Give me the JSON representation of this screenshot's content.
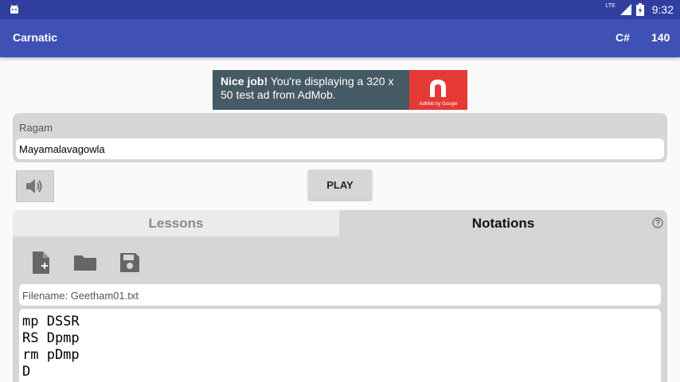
{
  "status_bar": {
    "network": "LTE",
    "time": "9:32"
  },
  "app_bar": {
    "title": "Carnatic",
    "key": "C#",
    "tempo": "140"
  },
  "ad": {
    "bold_text": "Nice job!",
    "text": " You're displaying a 320 x 50 test ad from AdMob.",
    "logo_caption": "AdMob by Google"
  },
  "ragam": {
    "label": "Ragam",
    "value": "Mayamalavagowla"
  },
  "controls": {
    "play_label": "PLAY"
  },
  "tabs": [
    {
      "label": "Lessons"
    },
    {
      "label": "Notations"
    }
  ],
  "notations": {
    "filename": "Filename: Geetham01.txt",
    "lines": [
      "mp DSSR",
      "RS Dpmp",
      "rm pDmp",
      "D"
    ]
  },
  "colors": {
    "status_bar": "#303f9f",
    "app_bar": "#3f51b5",
    "panel": "#d6d6d6",
    "ad_bg": "#455a64",
    "ad_logo": "#e53935"
  }
}
